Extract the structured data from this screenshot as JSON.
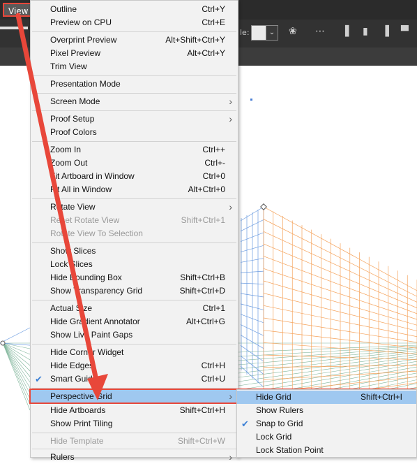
{
  "menubar": {
    "view_label": "View"
  },
  "toolbar": {
    "style_label": "le:"
  },
  "view_menu": {
    "items": [
      {
        "label": "Outline",
        "shortcut": "Ctrl+Y"
      },
      {
        "label": "Preview on CPU",
        "shortcut": "Ctrl+E"
      },
      {
        "label": "Overprint Preview",
        "shortcut": "Alt+Shift+Ctrl+Y"
      },
      {
        "label": "Pixel Preview",
        "shortcut": "Alt+Ctrl+Y"
      },
      {
        "label": "Trim View",
        "shortcut": ""
      },
      {
        "label": "Presentation Mode",
        "shortcut": ""
      },
      {
        "label": "Screen Mode",
        "shortcut": ""
      },
      {
        "label": "Proof Setup",
        "shortcut": ""
      },
      {
        "label": "Proof Colors",
        "shortcut": ""
      },
      {
        "label": "Zoom In",
        "shortcut": "Ctrl++"
      },
      {
        "label": "Zoom Out",
        "shortcut": "Ctrl+-"
      },
      {
        "label": "Fit Artboard in Window",
        "shortcut": "Ctrl+0"
      },
      {
        "label": "Fit All in Window",
        "shortcut": "Alt+Ctrl+0"
      },
      {
        "label": "Rotate View",
        "shortcut": ""
      },
      {
        "label": "Reset Rotate View",
        "shortcut": "Shift+Ctrl+1"
      },
      {
        "label": "Rotate View To Selection",
        "shortcut": ""
      },
      {
        "label": "Show Slices",
        "shortcut": ""
      },
      {
        "label": "Lock Slices",
        "shortcut": ""
      },
      {
        "label": "Hide Bounding Box",
        "shortcut": "Shift+Ctrl+B"
      },
      {
        "label": "Show Transparency Grid",
        "shortcut": "Shift+Ctrl+D"
      },
      {
        "label": "Actual Size",
        "shortcut": "Ctrl+1"
      },
      {
        "label": "Hide Gradient Annotator",
        "shortcut": "Alt+Ctrl+G"
      },
      {
        "label": "Show Live Paint Gaps",
        "shortcut": ""
      },
      {
        "label": "Hide Corner Widget",
        "shortcut": ""
      },
      {
        "label": "Hide Edges",
        "shortcut": "Ctrl+H"
      },
      {
        "label": "Smart Guides",
        "shortcut": "Ctrl+U"
      },
      {
        "label": "Perspective Grid",
        "shortcut": ""
      },
      {
        "label": "Hide Artboards",
        "shortcut": "Shift+Ctrl+H"
      },
      {
        "label": "Show Print Tiling",
        "shortcut": ""
      },
      {
        "label": "Hide Template",
        "shortcut": "Shift+Ctrl+W"
      },
      {
        "label": "Rulers",
        "shortcut": ""
      }
    ]
  },
  "perspective_submenu": {
    "items": [
      {
        "label": "Hide Grid",
        "shortcut": "Shift+Ctrl+I"
      },
      {
        "label": "Show Rulers",
        "shortcut": ""
      },
      {
        "label": "Snap to Grid",
        "shortcut": ""
      },
      {
        "label": "Lock Grid",
        "shortcut": ""
      },
      {
        "label": "Lock Station Point",
        "shortcut": ""
      }
    ]
  },
  "colors": {
    "annotation_red": "#e8473a",
    "highlight": "#9fc8f0",
    "grid_orange": "#f5a25a",
    "grid_blue": "#6a9be0",
    "grid_green": "#7fb59a"
  }
}
